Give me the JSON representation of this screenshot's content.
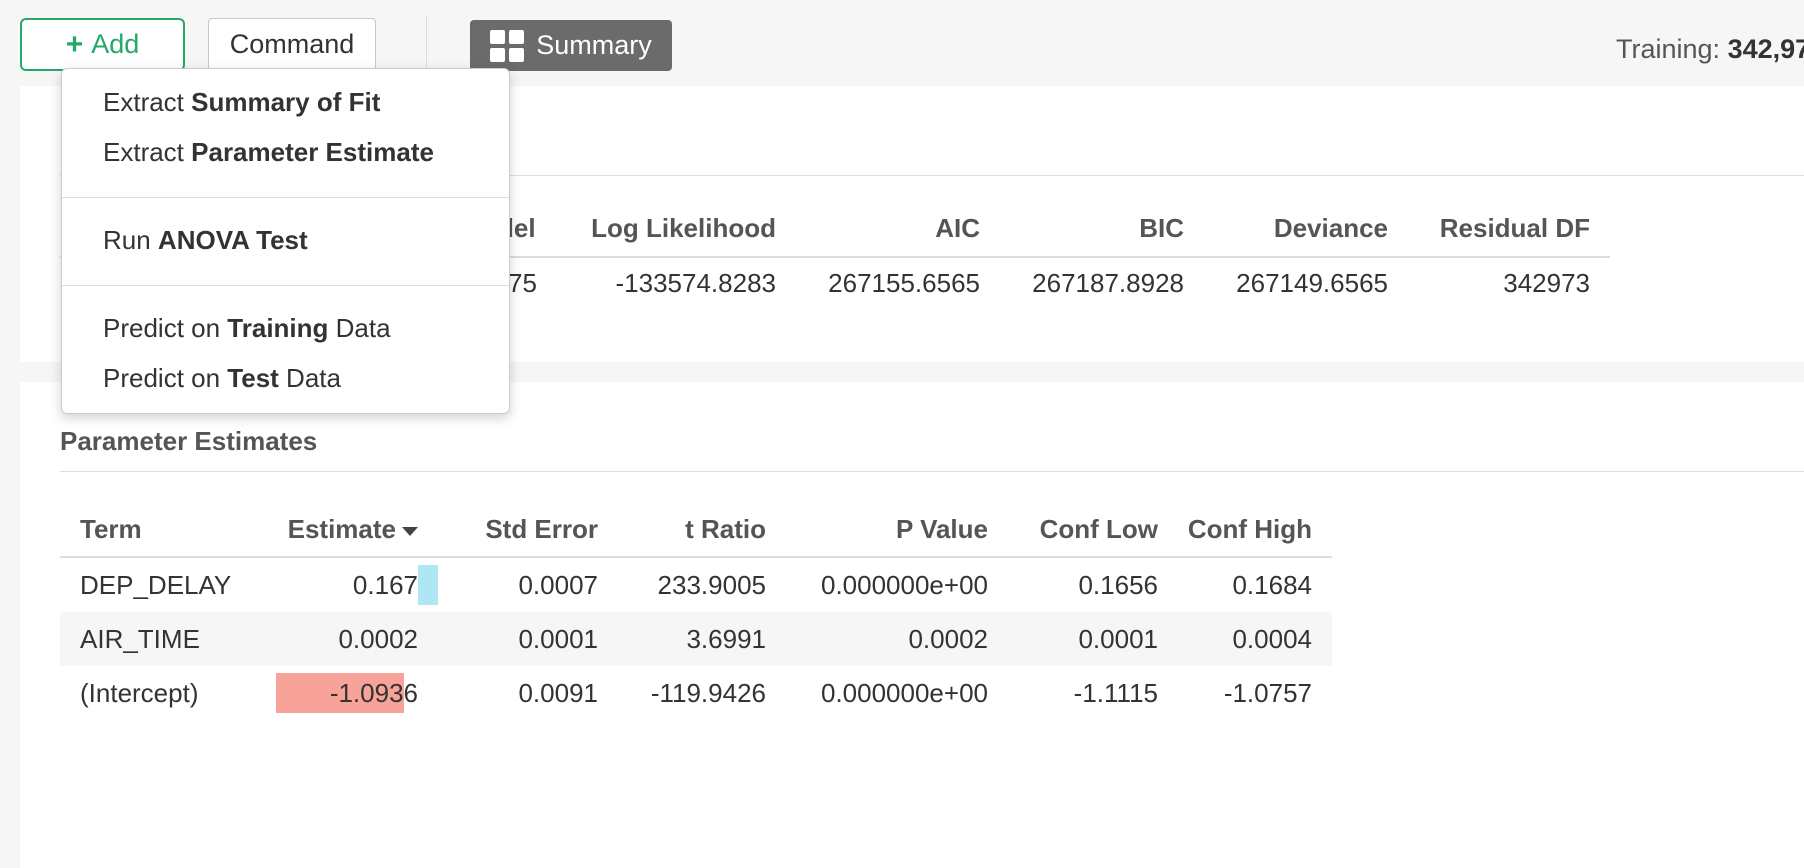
{
  "toolbar": {
    "add_label": "Add",
    "command_label": "Command",
    "summary_label": "Summary",
    "training_label": "Training:",
    "training_value": "342,97"
  },
  "menu": {
    "items": [
      {
        "prefix": "Extract ",
        "bold": "Summary of Fit",
        "suffix": ""
      },
      {
        "prefix": "Extract ",
        "bold": "Parameter Estimate",
        "suffix": ""
      },
      {
        "prefix": "Run ",
        "bold": "ANOVA Test",
        "suffix": ""
      },
      {
        "prefix": "Predict on ",
        "bold": "Training",
        "suffix": " Data"
      },
      {
        "prefix": "Predict on ",
        "bold": "Test",
        "suffix": " Data"
      }
    ]
  },
  "summary_of_fit": {
    "headers": [
      "del",
      "Log Likelihood",
      "AIC",
      "BIC",
      "Deviance",
      "Residual DF"
    ],
    "values": [
      "75",
      "-133574.8283",
      "267155.6565",
      "267187.8928",
      "267149.6565",
      "342973"
    ]
  },
  "parameter_estimates": {
    "title": "Parameter Estimates",
    "headers": [
      "Term",
      "Estimate",
      "Std Error",
      "t Ratio",
      "P Value",
      "Conf Low",
      "Conf High"
    ],
    "rows": [
      {
        "term": "DEP_DELAY",
        "estimate": "0.167",
        "std_error": "0.0007",
        "t_ratio": "233.9005",
        "p_value": "0.000000e+00",
        "conf_low": "0.1656",
        "conf_high": "0.1684"
      },
      {
        "term": "AIR_TIME",
        "estimate": "0.0002",
        "std_error": "0.0001",
        "t_ratio": "3.6991",
        "p_value": "0.0002",
        "conf_low": "0.0001",
        "conf_high": "0.0004"
      },
      {
        "term": "(Intercept)",
        "estimate": "-1.0936",
        "std_error": "0.0091",
        "t_ratio": "-119.9426",
        "p_value": "0.000000e+00",
        "conf_low": "-1.1115",
        "conf_high": "-1.0757"
      }
    ],
    "estimate_bars": [
      0.167,
      0.0002,
      -1.0936
    ]
  },
  "colors": {
    "accent_green": "#27a86b",
    "positive_bar": "#aee6f3",
    "negative_bar": "#f7a39a"
  }
}
